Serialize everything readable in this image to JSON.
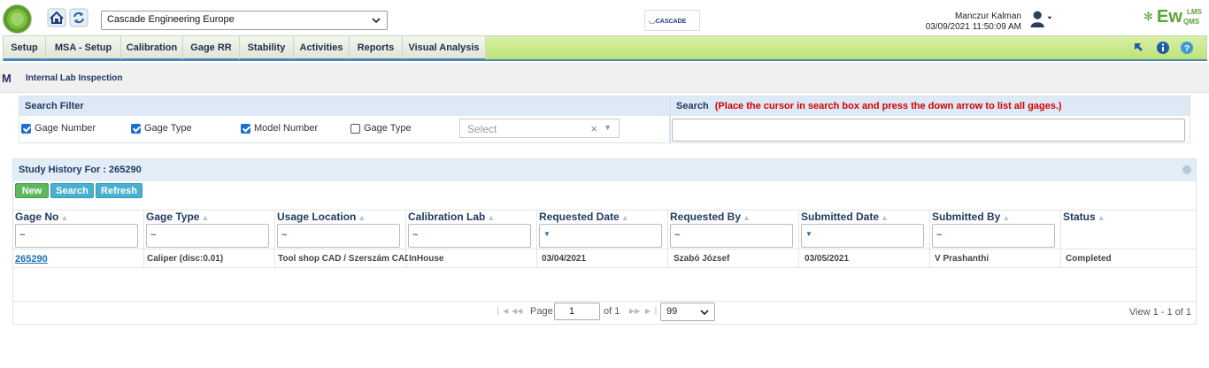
{
  "header": {
    "company_select": "Cascade Engineering Europe",
    "center_logo": "CASCADE",
    "user_name": "Manczur Kalman",
    "datetime": "03/09/2021 11:50:09 AM",
    "brand": "Ew",
    "brand_top": "LMS",
    "brand_sub": "QMS"
  },
  "menu": {
    "items": [
      {
        "label": "Setup"
      },
      {
        "label": "MSA - Setup"
      },
      {
        "label": "Calibration"
      },
      {
        "label": "Gage RR"
      },
      {
        "label": "Stability"
      },
      {
        "label": "Activities"
      },
      {
        "label": "Reports"
      },
      {
        "label": "Visual Analysis"
      }
    ]
  },
  "breadcrumb": {
    "logo": "M",
    "title": "Internal Lab Inspection"
  },
  "search_filter": {
    "title": "Search Filter",
    "options": [
      {
        "label": "Gage Number",
        "checked": true
      },
      {
        "label": "Gage Type",
        "checked": true
      },
      {
        "label": "Model Number",
        "checked": true
      },
      {
        "label": "Gage Type",
        "checked": false
      }
    ],
    "select_placeholder": "Select",
    "select_clear": "×",
    "select_arrow": "▼"
  },
  "search": {
    "title": "Search",
    "hint": "(Place the cursor in search box and press the down arrow to list all gages.)",
    "value": ""
  },
  "grid": {
    "title": "Study History For : 265290",
    "buttons": {
      "new": "New",
      "search": "Search",
      "refresh": "Refresh"
    },
    "columns": [
      {
        "label": "Gage No",
        "filter": "~"
      },
      {
        "label": "Gage Type",
        "filter": "~"
      },
      {
        "label": "Usage Location",
        "filter": "~"
      },
      {
        "label": "Calibration Lab",
        "filter": "~"
      },
      {
        "label": "Requested Date",
        "filter": "▼"
      },
      {
        "label": "Requested By",
        "filter": "~"
      },
      {
        "label": "Submitted Date",
        "filter": "▼"
      },
      {
        "label": "Submitted By",
        "filter": "~"
      },
      {
        "label": "Status",
        "filter": ""
      }
    ],
    "rows": [
      [
        "265290",
        "Caliper (disc:0.01)",
        "Tool shop CAD / Szerszám CAD",
        "InHouse",
        "03/04/2021",
        "Szabó József",
        "03/05/2021",
        "V Prashanthi",
        "Completed"
      ]
    ]
  },
  "pager": {
    "page_label": "Page",
    "page_value": "1",
    "of_label": "of 1",
    "per_page": "99",
    "view_text": "View 1 - 1 of 1"
  },
  "colors": {
    "menu_green": "#bfe277",
    "accent_blue": "#4a86b8",
    "hint_red": "#d40000"
  }
}
